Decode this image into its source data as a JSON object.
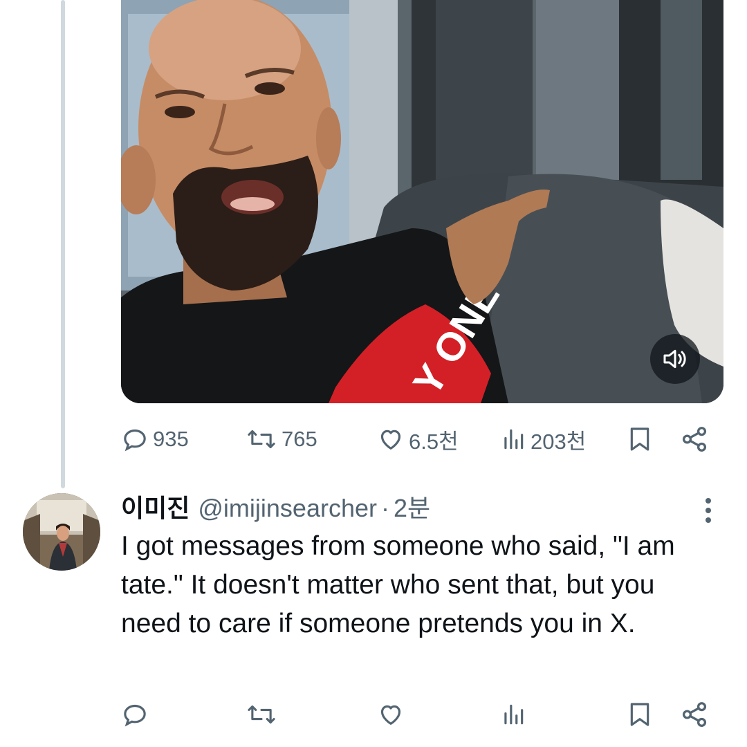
{
  "main_tweet": {
    "media": {
      "type": "video",
      "shirt_text": "Y ONE",
      "mute_button": "volume-icon"
    },
    "actions": {
      "reply_count": "935",
      "repost_count": "765",
      "like_count": "6.5천",
      "view_count": "203천"
    }
  },
  "reply": {
    "display_name": "이미진",
    "handle": "@imijinsearcher",
    "separator": "·",
    "time": "2분",
    "text": "I got messages from someone who said, \"I am tate.\" It doesn't matter who sent that, but you need to care if someone pretends you in X."
  },
  "colors": {
    "secondary_text": "#536471",
    "primary_text": "#0f1419",
    "thread_line": "#cfd9de"
  }
}
